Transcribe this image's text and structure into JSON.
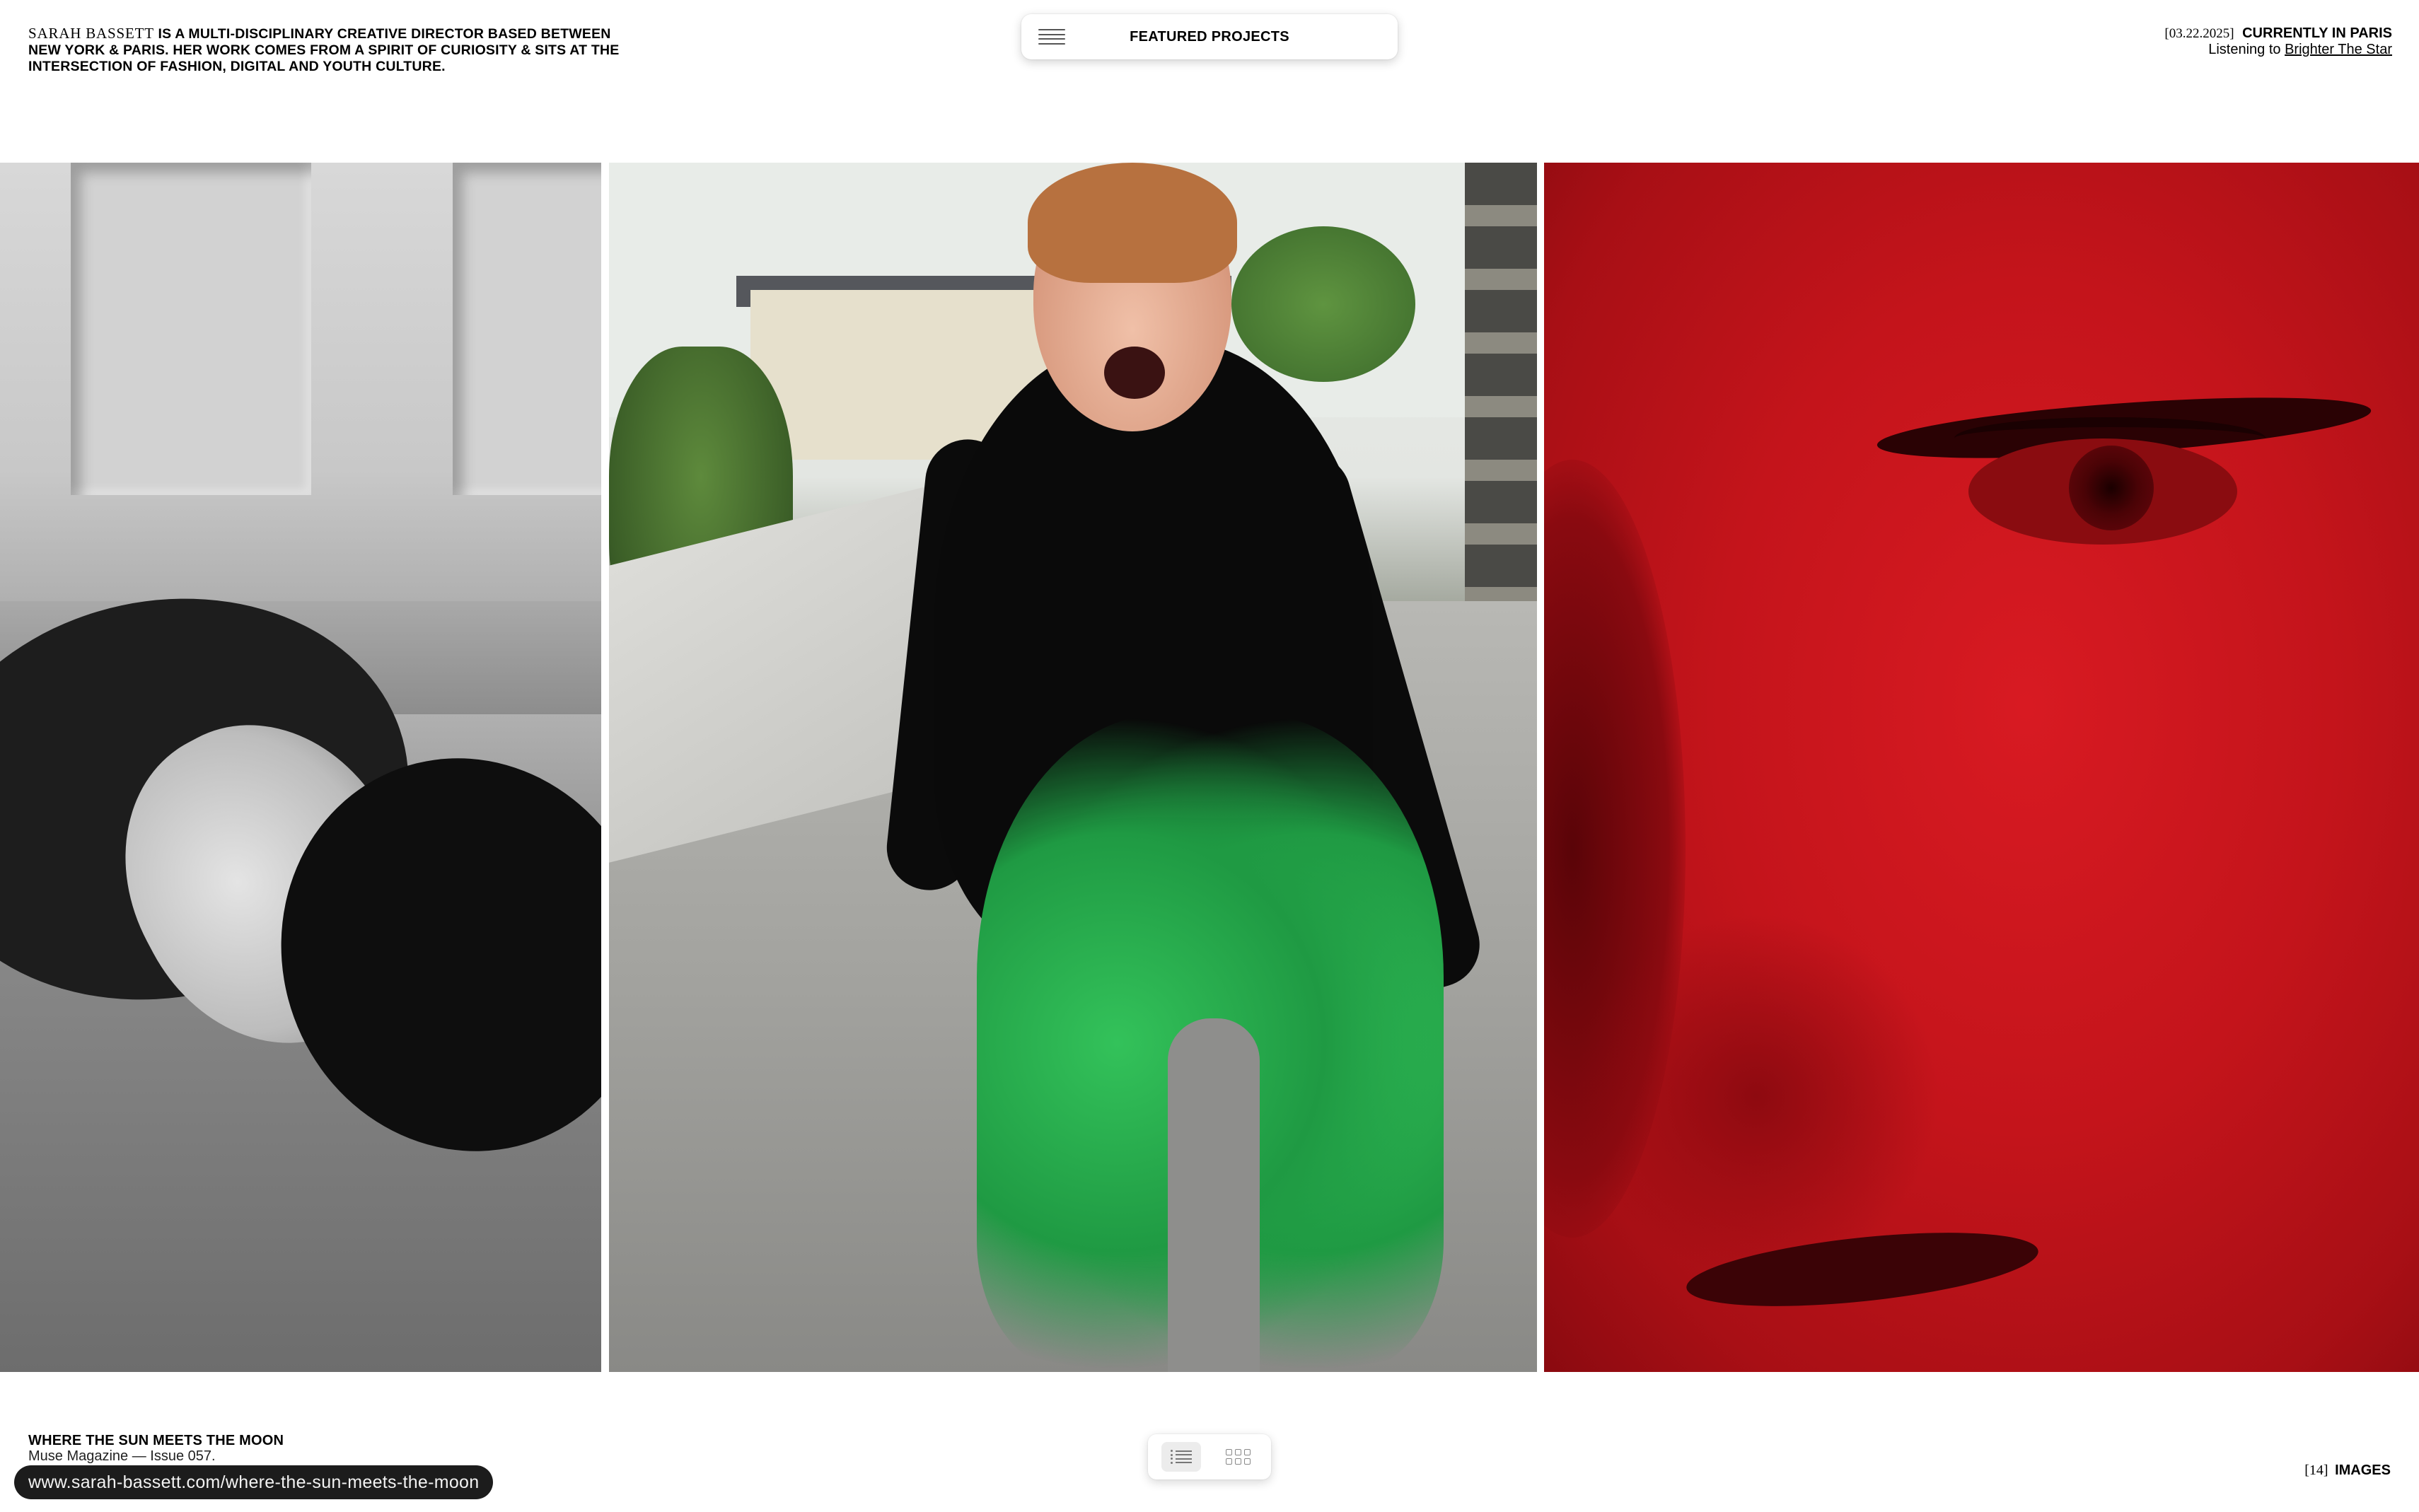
{
  "header": {
    "bio_name": "SARAH BASSETT",
    "bio_text": "IS A MULTI-DISCIPLINARY CREATIVE DIRECTOR BASED BETWEEN NEW YORK & PARIS. HER WORK COMES FROM A SPIRIT OF CURIOSITY & SITS AT THE INTERSECTION OF FASHION, DIGITAL AND YOUTH CULTURE.",
    "menu_icon": "hamburger-menu-icon",
    "menu_title": "FEATURED PROJECTS",
    "date": "[03.22.2025]",
    "current_location": "CURRENTLY IN PARIS",
    "listening_prefix": "Listening to",
    "song_link": "Brighter The Star"
  },
  "gallery": {
    "images": [
      {
        "description_name": "grayscale-portrait-on-floor",
        "dominant_color": "#8a8a8a"
      },
      {
        "description_name": "street-portrait-green-fringe-trousers",
        "dominant_color": "#1f9a43"
      },
      {
        "description_name": "red-tinted-face-closeup",
        "dominant_color": "#c4141b"
      }
    ]
  },
  "footer": {
    "project_title": "WHERE THE SUN MEETS THE MOON",
    "project_subtitle": "Muse Magazine — Issue 057.",
    "status_url": "www.sarah-bassett.com/where-the-sun-meets-the-moon",
    "view_toggle": {
      "list_icon": "list-view-icon",
      "grid_icon": "grid-view-icon",
      "active": "list"
    },
    "image_count": "[14]",
    "image_count_label": "IMAGES"
  }
}
